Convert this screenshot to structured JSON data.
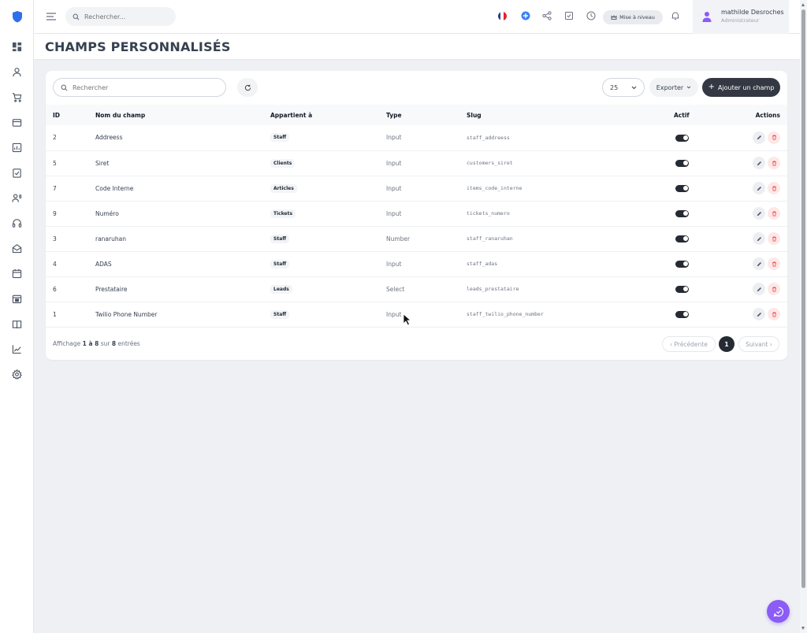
{
  "topbar": {
    "search_placeholder": "Rechercher...",
    "upgrade_label": "Mise à niveau",
    "user": {
      "name": "mathilde Desroches",
      "role": "Administrateur"
    }
  },
  "page": {
    "title": "CHAMPS PERSONNALISÉS"
  },
  "toolbar": {
    "search_placeholder": "Rechercher",
    "per_page": "25",
    "export_label": "Exporter",
    "add_label": "Ajouter un champ"
  },
  "table": {
    "headers": {
      "id": "ID",
      "name": "Nom du champ",
      "belongs": "Appartient à",
      "type": "Type",
      "slug": "Slug",
      "active": "Actif",
      "actions": "Actions"
    },
    "rows": [
      {
        "id": "2",
        "name": "Addreess",
        "belongs": "Staff",
        "type": "Input",
        "slug": "staff_addreess",
        "active": true
      },
      {
        "id": "5",
        "name": "Siret",
        "belongs": "Clients",
        "type": "Input",
        "slug": "customers_siret",
        "active": true
      },
      {
        "id": "7",
        "name": "Code Interne",
        "belongs": "Articles",
        "type": "Input",
        "slug": "items_code_interne",
        "active": true
      },
      {
        "id": "9",
        "name": "Numéro",
        "belongs": "Tickets",
        "type": "Input",
        "slug": "tickets_numero",
        "active": true
      },
      {
        "id": "3",
        "name": "ranaruhan",
        "belongs": "Staff",
        "type": "Number",
        "slug": "staff_ranaruhan",
        "active": true
      },
      {
        "id": "4",
        "name": "ADAS",
        "belongs": "Staff",
        "type": "Input",
        "slug": "staff_adas",
        "active": true
      },
      {
        "id": "6",
        "name": "Prestataire",
        "belongs": "Leads",
        "type": "Select",
        "slug": "leads_prestataire",
        "active": true
      },
      {
        "id": "1",
        "name": "Twilio Phone Number",
        "belongs": "Staff",
        "type": "Input",
        "slug": "staff_twilio_phone_number",
        "active": true
      }
    ]
  },
  "footer": {
    "info_prefix": "Affichage ",
    "info_range": "1 à 8",
    "info_middle": " sur ",
    "info_total": "8",
    "info_suffix": " entrées",
    "prev_label": "‹ Précédente",
    "current_page": "1",
    "next_label": "Suivant ›"
  },
  "colors": {
    "accent_dark": "#333842",
    "logo_blue": "#2f6fed",
    "fab_purple": "#8b5cf6",
    "delete_red": "#ef4444"
  },
  "icons": {
    "sidebar": [
      "dashboard-icon",
      "user-icon",
      "cart-icon",
      "wallet-icon",
      "report-icon",
      "clipboard-check-icon",
      "users-icon",
      "headset-icon",
      "mail-open-icon",
      "calendar-icon",
      "calendar-check-icon",
      "book-icon",
      "chart-line-icon",
      "settings-icon"
    ],
    "topbar": [
      "menu-icon",
      "search-icon",
      "french-flag-icon",
      "plus-circle-icon",
      "share-icon",
      "checkbox-icon",
      "clock-icon",
      "bell-icon"
    ]
  }
}
